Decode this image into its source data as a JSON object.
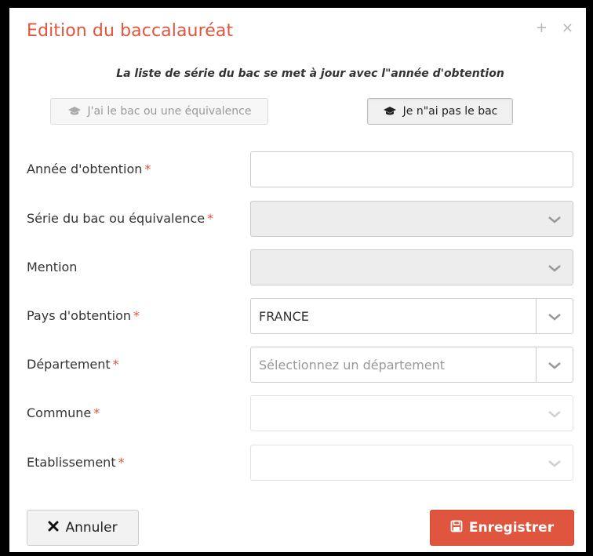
{
  "dialog": {
    "title": "Edition du baccalauréat",
    "info": "La liste de série du bac se met à jour avec l\"année d'obtention",
    "header_icons": [
      "plus-icon",
      "close-icon"
    ]
  },
  "toggles": {
    "has_bac": "J'ai le bac ou une équivalence",
    "no_bac": "Je n\"ai pas le bac"
  },
  "fields": {
    "annee": {
      "label": "Année d'obtention",
      "required": "*",
      "value": ""
    },
    "serie": {
      "label": "Série du bac ou équivalence",
      "required": "*",
      "value": ""
    },
    "mention": {
      "label": "Mention",
      "value": ""
    },
    "pays": {
      "label": "Pays d'obtention",
      "required": "*",
      "value": "FRANCE"
    },
    "departement": {
      "label": "Département",
      "required": "*",
      "placeholder": "Sélectionnez un département"
    },
    "commune": {
      "label": "Commune",
      "required": "*",
      "value": ""
    },
    "etablissement": {
      "label": "Etablissement",
      "required": "*",
      "value": ""
    }
  },
  "footer": {
    "cancel": "Annuler",
    "save": "Enregistrer"
  },
  "colors": {
    "accent": "#e0553e",
    "disabled_field": "#ededed"
  }
}
